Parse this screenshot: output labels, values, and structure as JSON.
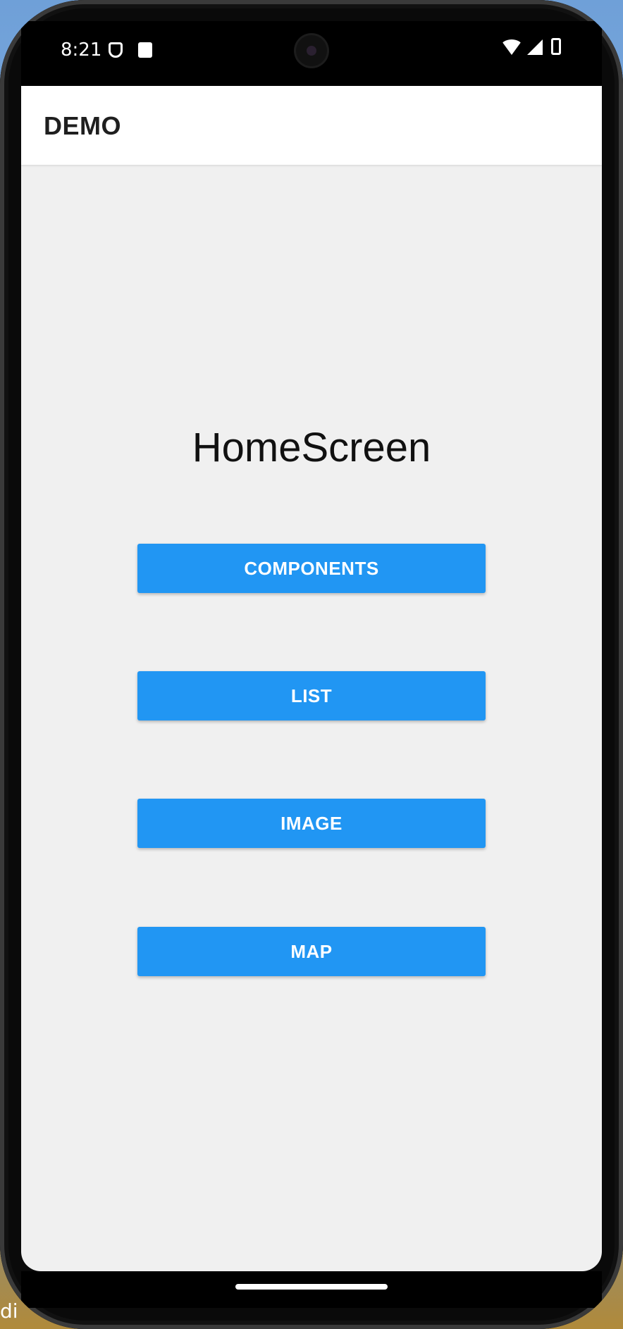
{
  "status_bar": {
    "time": "8:21",
    "icons": [
      "shield-icon",
      "sd-card-icon",
      "camera",
      "wifi-icon",
      "signal-icon",
      "battery-icon"
    ]
  },
  "app_bar": {
    "title": "DEMO"
  },
  "main": {
    "title": "HomeScreen",
    "buttons": [
      {
        "label": "COMPONENTS"
      },
      {
        "label": "LIST"
      },
      {
        "label": "IMAGE"
      },
      {
        "label": "MAP"
      }
    ]
  },
  "colors": {
    "accent": "#2196f3",
    "background": "#f0f0f0",
    "app_bar": "#ffffff"
  }
}
